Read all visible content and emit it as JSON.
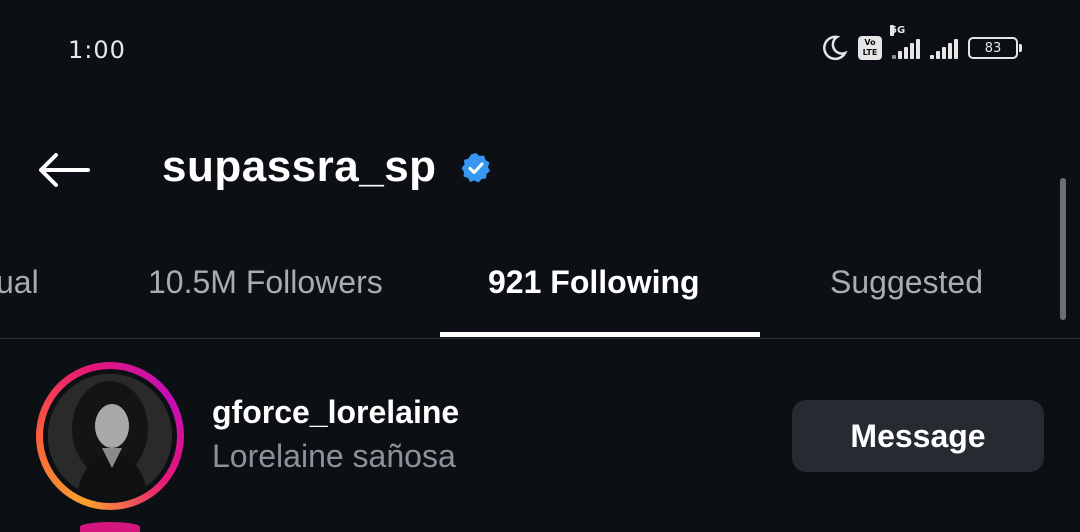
{
  "status_bar": {
    "time": "1:00",
    "volte_label": "Vo LTE",
    "network": "5G",
    "battery": "83"
  },
  "header": {
    "title": "supassra_sp",
    "verified": true
  },
  "tabs": [
    {
      "label": "ual",
      "active": false
    },
    {
      "label": "10.5M Followers",
      "active": false
    },
    {
      "label": "921 Following",
      "active": true
    },
    {
      "label": "Suggested",
      "active": false
    }
  ],
  "list": {
    "items": [
      {
        "username": "gforce_lorelaine",
        "full_name": "Lorelaine sañosa",
        "action_label": "Message"
      }
    ]
  },
  "colors": {
    "background": "#0c0f14",
    "verified": "#3797f0",
    "button_bg": "#262a31"
  },
  "icons": [
    "moon-icon",
    "volte-icon",
    "signal-icon",
    "battery-icon",
    "back-arrow-icon",
    "verified-badge-icon"
  ]
}
